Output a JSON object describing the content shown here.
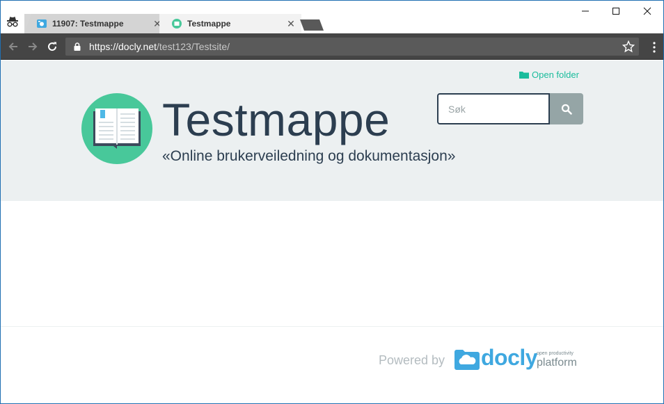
{
  "browser": {
    "tabs": [
      {
        "title": "11907: Testmappe",
        "active": false,
        "favicon": "camera-folder-icon"
      },
      {
        "title": "Testmappe",
        "active": true,
        "favicon": "book-icon"
      }
    ],
    "tab_close_glyph": "✕",
    "url_host": "https://docly.net",
    "url_path": "/test123/Testsite/",
    "window_controls": {
      "minimize": "—",
      "maximize": "☐",
      "close": "✕"
    }
  },
  "page": {
    "open_folder_label": "Open folder",
    "title": "Testmappe",
    "subtitle": "«Online brukerveiledning og dokumentasjon»",
    "search_placeholder": "Søk",
    "footer": {
      "powered_by": "Powered by",
      "brand": "docly",
      "brand_tag_small": "open productivity",
      "brand_tag_big": "platform"
    }
  },
  "colors": {
    "accent": "#1abc9c",
    "title": "#2c3e50",
    "hero_bg": "#ecf0f1",
    "logo_green": "#48c89a",
    "docly_blue": "#3fa8e0"
  }
}
